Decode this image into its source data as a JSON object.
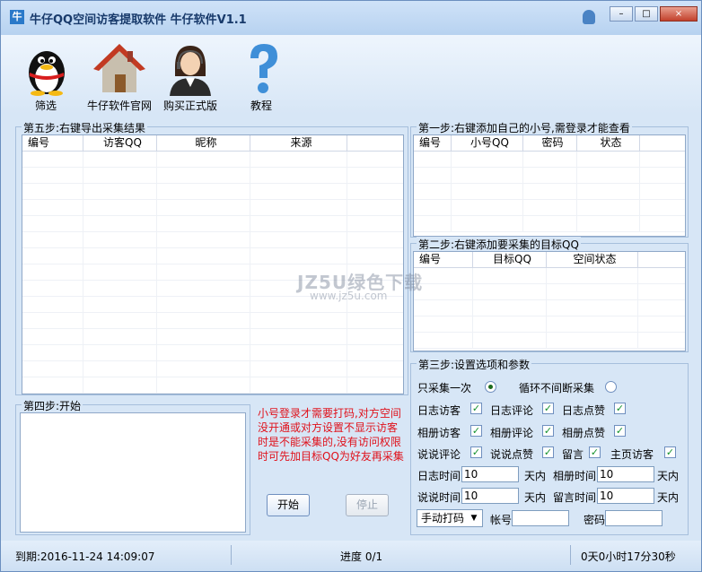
{
  "window": {
    "title": "牛仔QQ空间访客提取软件  牛仔软件V1.1",
    "app_icon": "牛",
    "controls": [
      "–",
      "□",
      "×"
    ]
  },
  "toolbar": {
    "items": [
      {
        "label": "筛选",
        "icon": "penguin-icon"
      },
      {
        "label": "牛仔软件官网",
        "icon": "house-icon"
      },
      {
        "label": "购买正式版",
        "icon": "support-person-icon"
      },
      {
        "label": "教程",
        "icon": "question-mark-icon"
      }
    ]
  },
  "step5": {
    "title": "第五步:右键导出采集结果",
    "columns": [
      "编号",
      "访客QQ",
      "昵称",
      "来源"
    ]
  },
  "step1": {
    "title": "第一步:右键添加自己的小号,需登录才能查看",
    "columns": [
      "编号",
      "小号QQ",
      "密码",
      "状态"
    ]
  },
  "step2": {
    "title": "第二步:右键添加要采集的目标QQ",
    "columns": [
      "编号",
      "目标QQ",
      "空间状态"
    ]
  },
  "step4": {
    "title": "第四步:开始"
  },
  "note": "小号登录才需要打码,对方空间没开通或对方设置不显示访客时是不能采集的,没有访问权限时可先加目标QQ为好友再采集",
  "buttons": {
    "start": "开始",
    "stop": "停止"
  },
  "step3": {
    "title": "第三步:设置选项和参数",
    "radio_only_once": "只采集一次",
    "radio_loop": "循环不间断采集",
    "checks": [
      {
        "label": "日志访客",
        "checked": true
      },
      {
        "label": "日志评论",
        "checked": true
      },
      {
        "label": "日志点赞",
        "checked": true
      },
      {
        "label": "相册访客",
        "checked": true
      },
      {
        "label": "相册评论",
        "checked": true
      },
      {
        "label": "相册点赞",
        "checked": true
      },
      {
        "label": "说说评论",
        "checked": true
      },
      {
        "label": "说说点赞",
        "checked": true
      },
      {
        "label": "留言",
        "checked": true
      },
      {
        "label": "主页访客",
        "checked": true
      }
    ],
    "log_time_label": "日志时间",
    "log_time_value": "10",
    "unit_days": "天内",
    "album_time_label": "相册时间",
    "album_time_value": "10",
    "shuoshuo_time_label": "说说时间",
    "shuoshuo_time_value": "10",
    "msg_time_label": "留言时间",
    "msg_time_value": "10",
    "captcha_select": "手动打码",
    "account_label": "帐号",
    "password_label": "密码"
  },
  "status": {
    "expiry": "到期:2016-11-24 14:09:07",
    "progress": "进度 0/1",
    "elapsed": "0天0小时17分30秒"
  },
  "watermark": {
    "line1": "JZ5U绿色下载",
    "line2": "www.jz5u.com"
  },
  "colors": {
    "accent": "#2a79c9",
    "note_red": "#e0111b",
    "check_green": "#14912c"
  }
}
